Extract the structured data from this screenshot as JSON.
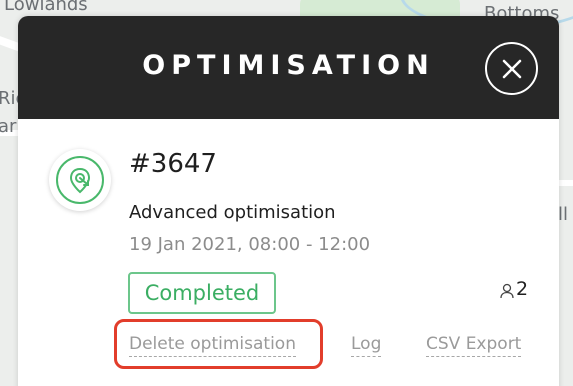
{
  "map": {
    "labels": [
      "Lowlands",
      "Bottoms",
      "Ric",
      "ar",
      "ll"
    ]
  },
  "modal": {
    "title": "OPTIMISATION",
    "close_icon": "close-icon"
  },
  "job": {
    "icon": "route-pin-icon",
    "id": "#3647",
    "type": "Advanced optimisation",
    "date": "19 Jan 2021, 08:00 - 12:00",
    "status": "Completed",
    "status_color": "#3bae63",
    "assignee_icon": "user-icon",
    "assignee_count": "2"
  },
  "actions": {
    "delete_label": "Delete optimisation",
    "log_label": "Log",
    "csv_label": "CSV Export"
  },
  "colors": {
    "header": "#272727",
    "accent_green": "#49b86b",
    "highlight_red": "#e23d2b"
  }
}
